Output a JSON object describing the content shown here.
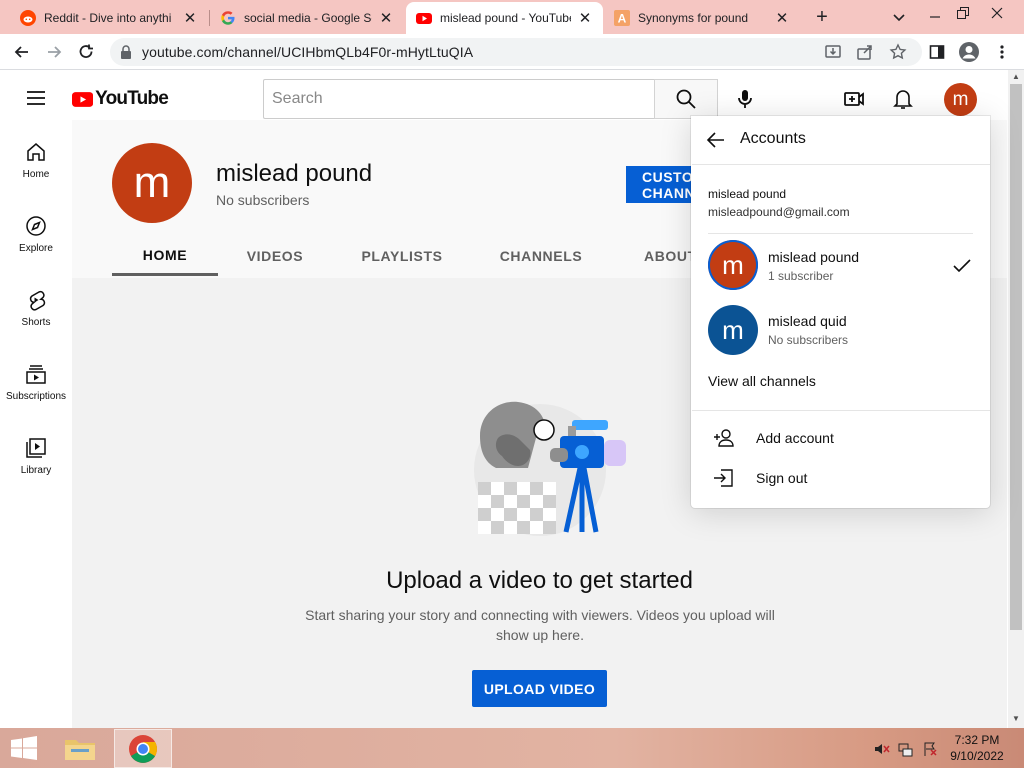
{
  "browser": {
    "tabs": [
      {
        "title": "Reddit - Dive into anythi",
        "icon": "reddit-icon"
      },
      {
        "title": "social media - Google Se",
        "icon": "google-icon"
      },
      {
        "title": "mislead pound - YouTube",
        "icon": "youtube-icon",
        "active": true
      },
      {
        "title": "Synonyms for pound",
        "icon": "thesaurus-icon"
      }
    ],
    "url": "youtube.com/channel/UCIHbmQLb4F0r-mHytLtuQIA"
  },
  "header": {
    "logo_text": "YouTube",
    "search_placeholder": "Search",
    "avatar_letter": "m"
  },
  "sidebar": {
    "items": [
      {
        "label": "Home",
        "icon": "home-icon"
      },
      {
        "label": "Explore",
        "icon": "compass-icon"
      },
      {
        "label": "Shorts",
        "icon": "shorts-icon"
      },
      {
        "label": "Subscriptions",
        "icon": "subscriptions-icon"
      },
      {
        "label": "Library",
        "icon": "library-icon"
      }
    ]
  },
  "channel": {
    "avatar_letter": "m",
    "name": "mislead pound",
    "subscribers": "No subscribers",
    "customize_label": "CUSTOMIZE CHANNEL",
    "tabs": [
      "HOME",
      "VIDEOS",
      "PLAYLISTS",
      "CHANNELS",
      "ABOUT"
    ]
  },
  "empty_state": {
    "title": "Upload a video to get started",
    "description": "Start sharing your story and connecting with viewers. Videos you upload will show up here.",
    "button": "UPLOAD VIDEO"
  },
  "accounts_popup": {
    "title": "Accounts",
    "google_account_name": "mislead pound",
    "email": "misleadpound@gmail.com",
    "channels": [
      {
        "letter": "m",
        "name": "mislead pound",
        "subs": "1 subscriber",
        "selected": true,
        "color": "#c23d13"
      },
      {
        "letter": "m",
        "name": "mislead quid",
        "subs": "No subscribers",
        "selected": false,
        "color": "#0b5394"
      }
    ],
    "view_all": "View all channels",
    "add_account": "Add account",
    "sign_out": "Sign out"
  },
  "taskbar": {
    "time": "7:32 PM",
    "date": "9/10/2022"
  },
  "colors": {
    "yt_red": "#ff0000",
    "blue": "#065fd4",
    "avatar_orange": "#c23d13",
    "avatar_blue": "#0b5394"
  }
}
